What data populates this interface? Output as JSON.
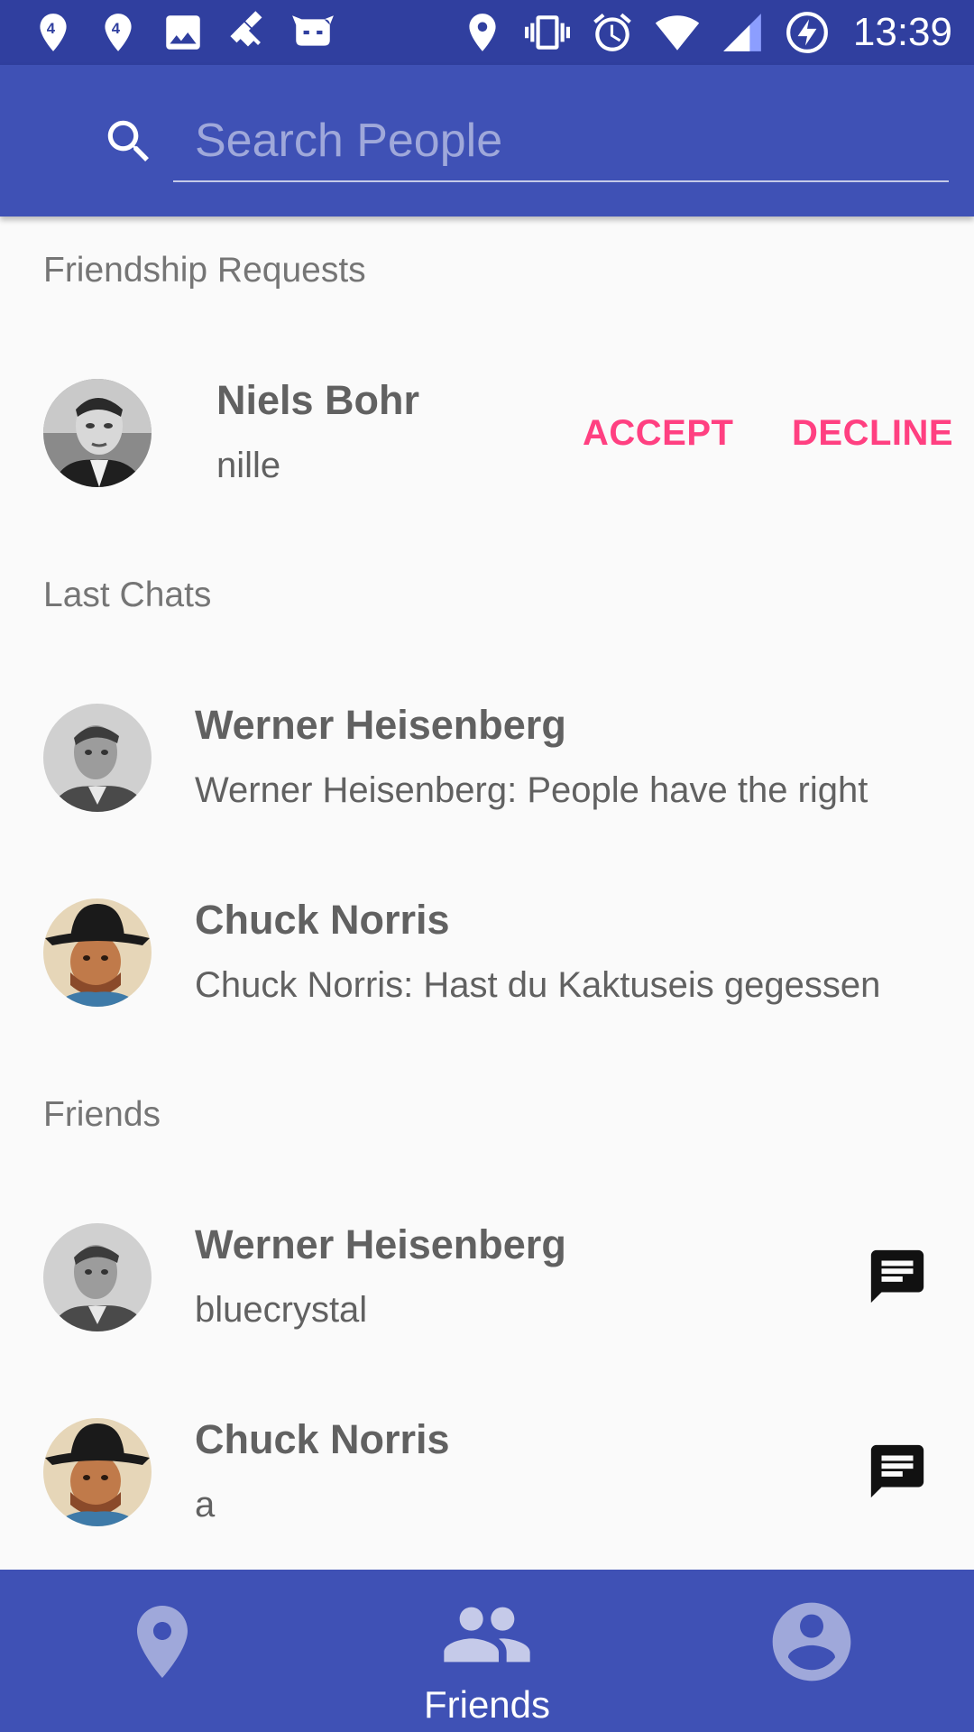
{
  "status_bar": {
    "time": "13:39",
    "left_icons": [
      "4g-location-icon",
      "4g-location-icon",
      "image-icon",
      "fake-gps-icon",
      "cyanogen-icon"
    ],
    "right_icons": [
      "location-icon",
      "vibrate-icon",
      "alarm-icon",
      "wifi-icon",
      "signal-icon",
      "battery-charging-icon"
    ]
  },
  "search": {
    "placeholder": "Search People",
    "value": "",
    "icon": "search-icon"
  },
  "friend_requests": {
    "header": "Friendship Requests",
    "items": [
      {
        "name": "Niels Bohr",
        "username": "nille",
        "accept_label": "ACCEPT",
        "decline_label": "DECLINE"
      }
    ]
  },
  "last_chats": {
    "header": "Last Chats",
    "items": [
      {
        "name": "Werner Heisenberg",
        "message": "Werner Heisenberg: People have the right"
      },
      {
        "name": "Chuck Norris",
        "message": "Chuck Norris: Hast du Kaktuseis gegessen"
      }
    ]
  },
  "friends": {
    "header": "Friends",
    "items": [
      {
        "name": "Werner Heisenberg",
        "username": "bluecrystal",
        "action_icon": "chat-icon"
      },
      {
        "name": "Chuck Norris",
        "username": "a",
        "action_icon": "chat-icon"
      }
    ]
  },
  "bottom_nav": {
    "items": [
      {
        "icon": "map-pin-icon",
        "label": "",
        "active": false
      },
      {
        "icon": "people-icon",
        "label": "Friends",
        "active": true
      },
      {
        "icon": "account-icon",
        "label": "",
        "active": false
      }
    ]
  },
  "colors": {
    "status_bar": "#303f9f",
    "primary": "#3f51b5",
    "accent": "#ff4081",
    "inactive_icon": "#9fa8da",
    "text_secondary": "#757575",
    "text_primary": "#616161"
  }
}
